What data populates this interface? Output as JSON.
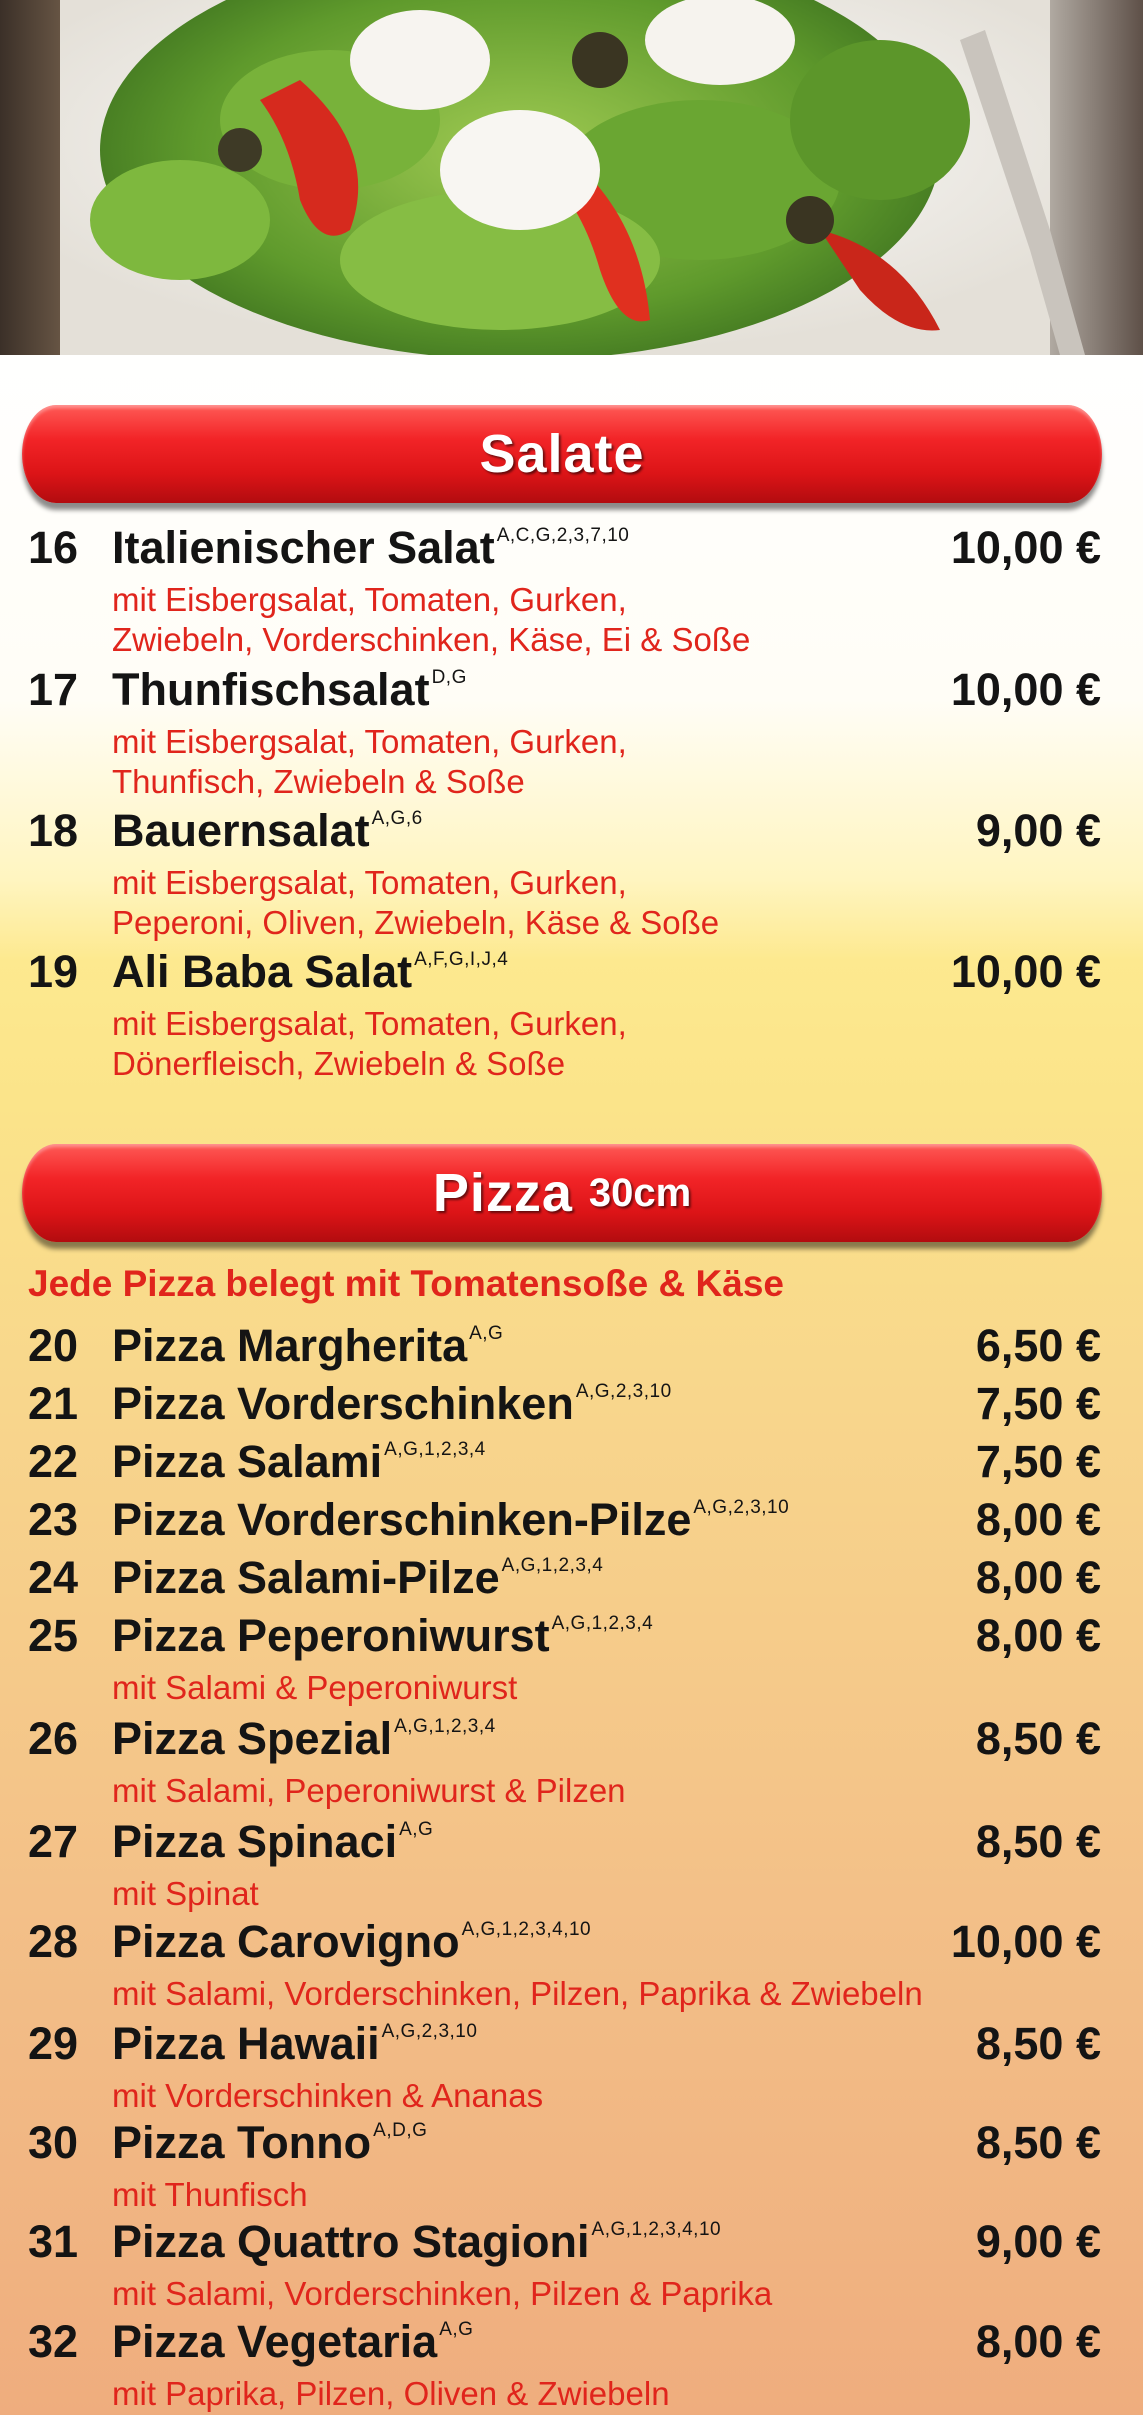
{
  "header_image": {
    "alt": ""
  },
  "sections": {
    "salate": {
      "title": "Salate",
      "items": [
        {
          "num": "16",
          "name": "Italienischer Salat",
          "allergens": "A,C,G,2,3,7,10",
          "price": "10,00 €",
          "desc": [
            "mit Eisbergsalat, Tomaten, Gurken,",
            "Zwiebeln, Vorderschinken, Käse, Ei & Soße"
          ]
        },
        {
          "num": "17",
          "name": "Thunfischsalat",
          "allergens": "D,G",
          "price": "10,00 €",
          "desc": [
            "mit Eisbergsalat, Tomaten, Gurken,",
            "Thunfisch, Zwiebeln & Soße"
          ]
        },
        {
          "num": "18",
          "name": "Bauernsalat",
          "allergens": "A,G,6",
          "price": "9,00 €",
          "desc": [
            "mit Eisbergsalat, Tomaten, Gurken,",
            "Peperoni, Oliven, Zwiebeln, Käse & Soße"
          ]
        },
        {
          "num": "19",
          "name": "Ali Baba Salat",
          "allergens": "A,F,G,I,J,4",
          "price": "10,00 €",
          "desc": [
            "mit Eisbergsalat, Tomaten, Gurken,",
            "Dönerfleisch, Zwiebeln & Soße"
          ]
        }
      ]
    },
    "pizza": {
      "title": "Pizza",
      "size": "30cm",
      "notice": "Jede Pizza belegt mit Tomatensoße & Käse",
      "items": [
        {
          "num": "20",
          "name": "Pizza Margherita",
          "allergens": "A,G",
          "price": "6,50 €",
          "desc": []
        },
        {
          "num": "21",
          "name": "Pizza Vorderschinken",
          "allergens": "A,G,2,3,10",
          "price": "7,50 €",
          "desc": []
        },
        {
          "num": "22",
          "name": "Pizza Salami",
          "allergens": "A,G,1,2,3,4",
          "price": "7,50 €",
          "desc": []
        },
        {
          "num": "23",
          "name": "Pizza Vorderschinken-Pilze",
          "allergens": "A,G,2,3,10",
          "price": "8,00 €",
          "desc": []
        },
        {
          "num": "24",
          "name": "Pizza Salami-Pilze",
          "allergens": "A,G,1,2,3,4",
          "price": "8,00 €",
          "desc": []
        },
        {
          "num": "25",
          "name": "Pizza Peperoniwurst",
          "allergens": "A,G,1,2,3,4",
          "price": "8,00 €",
          "desc": [
            "mit Salami & Peperoniwurst"
          ]
        },
        {
          "num": "26",
          "name": "Pizza Spezial",
          "allergens": "A,G,1,2,3,4",
          "price": "8,50 €",
          "desc": [
            "mit Salami, Peperoniwurst & Pilzen"
          ]
        },
        {
          "num": "27",
          "name": "Pizza Spinaci",
          "allergens": "A,G",
          "price": "8,50 €",
          "desc": [
            "mit Spinat"
          ]
        },
        {
          "num": "28",
          "name": "Pizza Carovigno",
          "allergens": "A,G,1,2,3,4,10",
          "price": "10,00 €",
          "desc": [
            "mit Salami, Vorderschinken, Pilzen, Paprika & Zwiebeln"
          ]
        },
        {
          "num": "29",
          "name": "Pizza Hawaii",
          "allergens": "A,G,2,3,10",
          "price": "8,50 €",
          "desc": [
            "mit Vorderschinken & Ananas"
          ]
        },
        {
          "num": "30",
          "name": "Pizza Tonno",
          "allergens": "A,D,G",
          "price": "8,50 €",
          "desc": [
            "mit Thunfisch"
          ]
        },
        {
          "num": "31",
          "name": "Pizza Quattro Stagioni",
          "allergens": "A,G,1,2,3,4,10",
          "price": "9,00 €",
          "desc": [
            "mit Salami,  Vorderschinken, Pilzen & Paprika"
          ]
        },
        {
          "num": "32",
          "name": "Pizza Vegetaria",
          "allergens": "A,G",
          "price": "8,00 €",
          "desc": [
            "mit Paprika, Pilzen, Oliven & Zwiebeln"
          ]
        }
      ]
    }
  },
  "colors": {
    "banner_red": "#e41d20",
    "description_red": "#e0251c",
    "text_dark": "#141414"
  }
}
